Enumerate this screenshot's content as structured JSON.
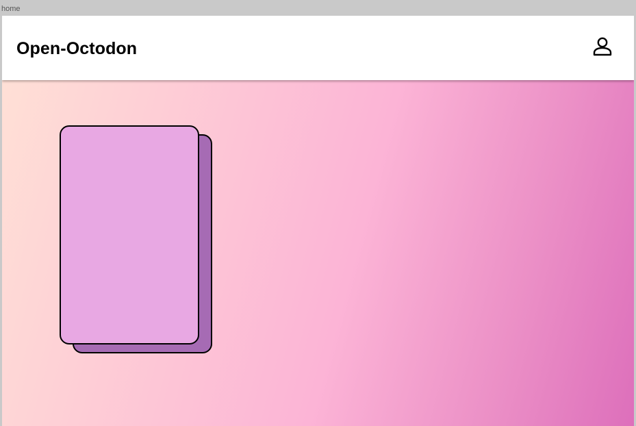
{
  "tab": {
    "label": "home"
  },
  "header": {
    "title": "Open-Octodon",
    "profile_icon": "user-icon"
  },
  "colors": {
    "header_bg": "#ffffff",
    "card_front": "#e8a8e3",
    "card_back": "#a66bb4",
    "gradient_start": "#ffe0d6",
    "gradient_end": "#dd6fbb"
  }
}
